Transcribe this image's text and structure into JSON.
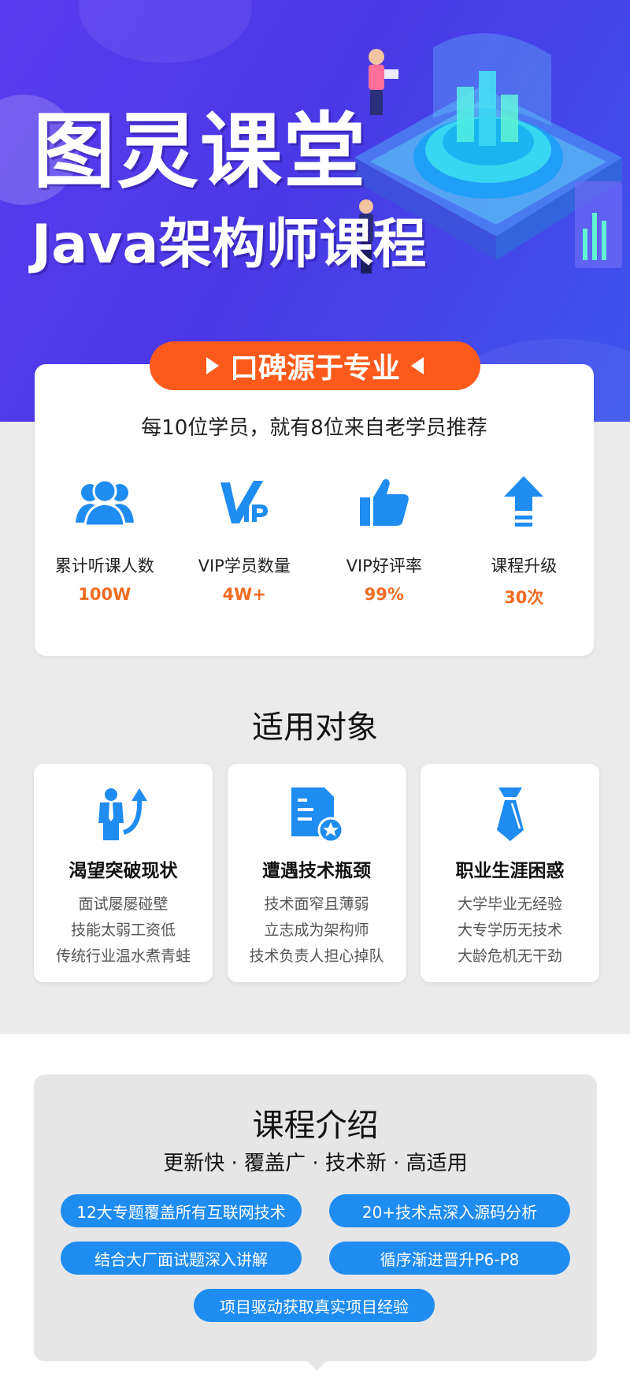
{
  "hero": {
    "title": "图灵课堂",
    "subtitle": "Java架构师课程"
  },
  "reputation": {
    "banner": "口碑源于专业",
    "tagline": "每10位学员，就有8位来自老学员推荐",
    "stats": [
      {
        "icon": "users-icon",
        "label": "累计听课人数",
        "value": "100W"
      },
      {
        "icon": "vip-icon",
        "label": "VIP学员数量",
        "value": "4W+"
      },
      {
        "icon": "thumbs-up-icon",
        "label": "VIP好评率",
        "value": "99%"
      },
      {
        "icon": "upgrade-arrow-icon",
        "label": "课程升级",
        "value": "30次"
      }
    ]
  },
  "audience": {
    "title": "适用对象",
    "cards": [
      {
        "icon": "person-arrow-up-icon",
        "title": "渴望突破现状",
        "lines": [
          "面试屡屡碰壁",
          "技能太弱工资低",
          "传统行业温水煮青蛙"
        ]
      },
      {
        "icon": "document-badge-icon",
        "title": "遭遇技术瓶颈",
        "lines": [
          "技术面窄且薄弱",
          "立志成为架构师",
          "技术负责人担心掉队"
        ]
      },
      {
        "icon": "necktie-icon",
        "title": "职业生涯困惑",
        "lines": [
          "大学毕业无经验",
          "大专学历无技术",
          "大龄危机无干劲"
        ]
      }
    ]
  },
  "course": {
    "title": "课程介绍",
    "subtitle": "更新快 · 覆盖广 · 技术新 · 高适用",
    "features": [
      "12大专题覆盖所有互联网技术",
      "20+技术点深入源码分析",
      "结合大厂面试题深入讲解",
      "循序渐进晋升P6-P8",
      "项目驱动获取真实项目经验"
    ]
  },
  "colors": {
    "hero_bg": "#4a38e6",
    "accent_orange": "#fc5a1c",
    "stat_value": "#f26b21",
    "icon_blue": "#1f8cf1"
  }
}
